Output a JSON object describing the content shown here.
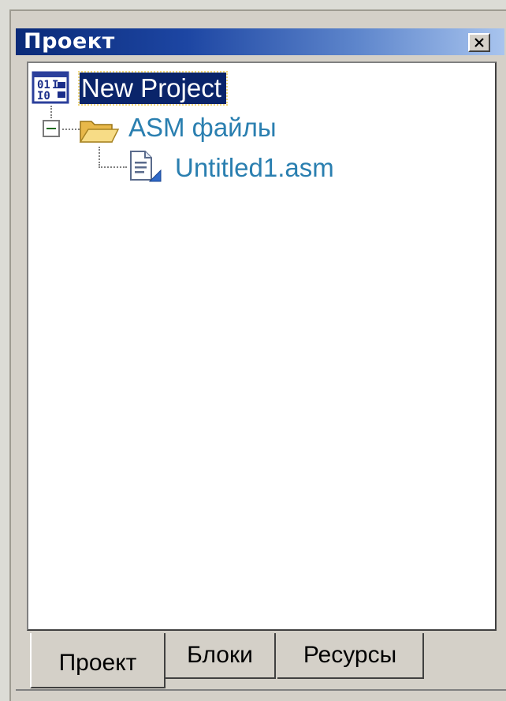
{
  "panel": {
    "title": "Проект",
    "close_icon": "close-icon"
  },
  "tree": {
    "root": {
      "label": "New Project",
      "icon": "project-icon",
      "selected": true
    },
    "folder": {
      "label": "ASM файлы",
      "icon": "open-folder-icon",
      "expanded": true
    },
    "file": {
      "label": "Untitled1.asm",
      "icon": "document-icon"
    }
  },
  "tabs": [
    {
      "label": "Проект",
      "active": true
    },
    {
      "label": "Блоки",
      "active": false
    },
    {
      "label": "Ресурсы",
      "active": false
    }
  ],
  "colors": {
    "selection": "#0a246a",
    "node_text": "#2a7fb0",
    "title_gradient_start": "#0a2a78",
    "title_gradient_end": "#a8c4ee"
  }
}
